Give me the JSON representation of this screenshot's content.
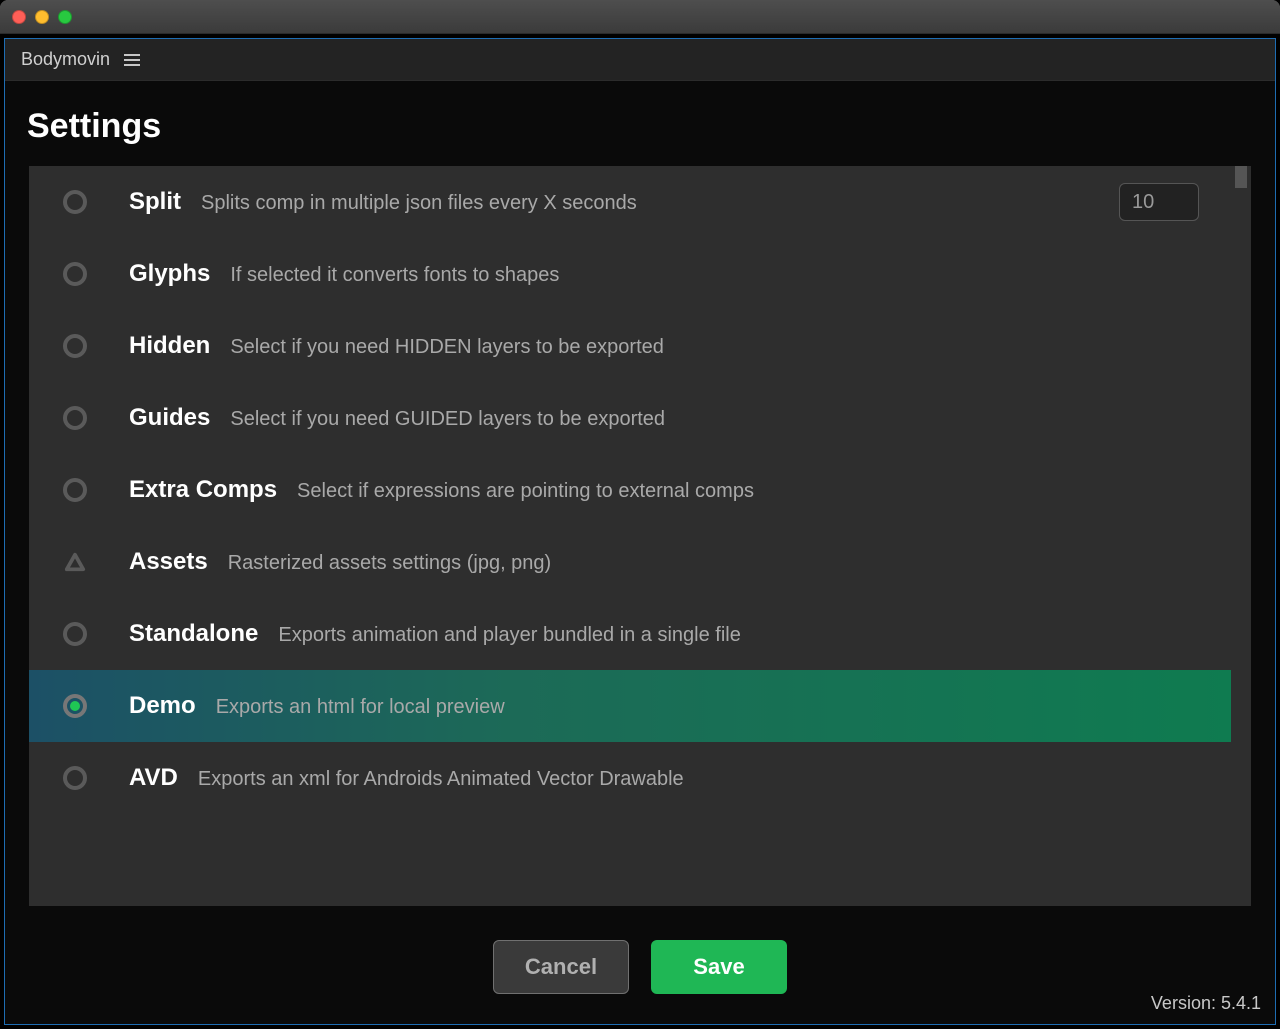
{
  "window": {
    "app_name": "Bodymovin"
  },
  "page": {
    "title": "Settings"
  },
  "settings": {
    "rows": [
      {
        "key": "split",
        "label": "Split",
        "desc": "Splits comp in multiple json files every X seconds",
        "icon": "radio",
        "selected": false,
        "has_input": true,
        "input_value": "10"
      },
      {
        "key": "glyphs",
        "label": "Glyphs",
        "desc": "If selected it converts fonts to shapes",
        "icon": "radio",
        "selected": false
      },
      {
        "key": "hidden",
        "label": "Hidden",
        "desc": "Select if you need HIDDEN layers to be exported",
        "icon": "radio",
        "selected": false
      },
      {
        "key": "guides",
        "label": "Guides",
        "desc": "Select if you need GUIDED layers to be exported",
        "icon": "radio",
        "selected": false
      },
      {
        "key": "extra-comps",
        "label": "Extra Comps",
        "desc": "Select if expressions are pointing to external comps",
        "icon": "radio",
        "selected": false
      },
      {
        "key": "assets",
        "label": "Assets",
        "desc": "Rasterized assets settings (jpg, png)",
        "icon": "triangle",
        "selected": false
      },
      {
        "key": "standalone",
        "label": "Standalone",
        "desc": "Exports animation and player bundled in a single file",
        "icon": "radio",
        "selected": false
      },
      {
        "key": "demo",
        "label": "Demo",
        "desc": "Exports an html for local preview",
        "icon": "radio",
        "selected": true
      },
      {
        "key": "avd",
        "label": "AVD",
        "desc": "Exports an xml for Androids Animated Vector Drawable",
        "icon": "radio",
        "selected": false
      }
    ]
  },
  "buttons": {
    "cancel": "Cancel",
    "save": "Save"
  },
  "footer": {
    "version_label": "Version: 5.4.1"
  }
}
